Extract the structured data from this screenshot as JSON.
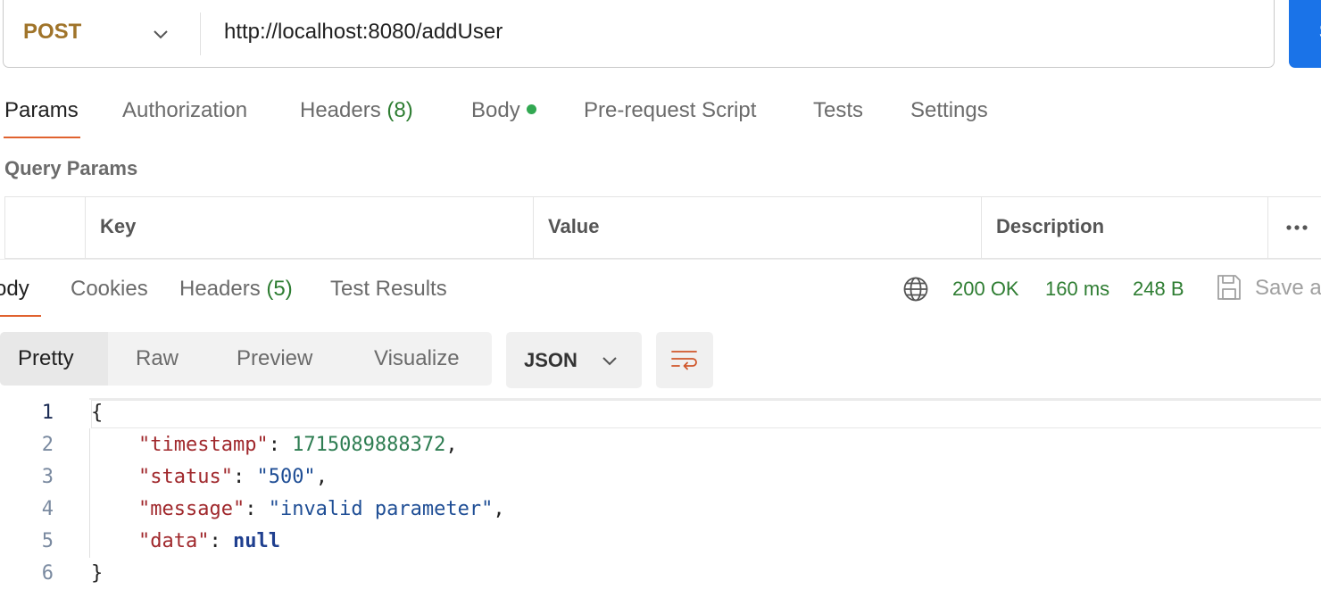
{
  "request": {
    "method": "POST",
    "url": "http://localhost:8080/addUser",
    "send_label": "S"
  },
  "request_tabs": [
    {
      "label": "Params",
      "active": true
    },
    {
      "label": "Authorization"
    },
    {
      "label": "Headers",
      "count": "(8)"
    },
    {
      "label": "Body",
      "indicator": "green-dot"
    },
    {
      "label": "Pre-request Script"
    },
    {
      "label": "Tests"
    },
    {
      "label": "Settings"
    }
  ],
  "query_params": {
    "title": "Query Params",
    "columns": [
      "Key",
      "Value",
      "Description"
    ],
    "more_icon": "ellipsis-icon"
  },
  "response_tabs": [
    {
      "label": "Body",
      "display": "ody",
      "active": true
    },
    {
      "label": "Cookies"
    },
    {
      "label": "Headers",
      "count": "(5)"
    },
    {
      "label": "Test Results"
    }
  ],
  "response_meta": {
    "status": "200 OK",
    "time": "160 ms",
    "size": "248 B",
    "save_label": "Save a",
    "globe_icon": "globe-icon",
    "save_icon": "save-icon"
  },
  "view_modes": [
    "Pretty",
    "Raw",
    "Preview",
    "Visualize"
  ],
  "active_view": "Pretty",
  "format": "JSON",
  "wrap_icon": "wrap-lines-icon",
  "code_lines": [
    {
      "num": "1",
      "text": "{"
    },
    {
      "num": "2",
      "key": "\"timestamp\"",
      "value": "1715089888372",
      "type": "number",
      "trail": ","
    },
    {
      "num": "3",
      "key": "\"status\"",
      "value": "\"500\"",
      "type": "string",
      "trail": ","
    },
    {
      "num": "4",
      "key": "\"message\"",
      "value": "\"invalid parameter\"",
      "type": "string",
      "trail": ","
    },
    {
      "num": "5",
      "key": "\"data\"",
      "value": "null",
      "type": "keyword",
      "trail": ""
    },
    {
      "num": "6",
      "text": "}"
    }
  ],
  "colors": {
    "accent": "#e0622f",
    "method": "#a0742a",
    "success": "#2e7d32",
    "send": "#1a73e8"
  }
}
